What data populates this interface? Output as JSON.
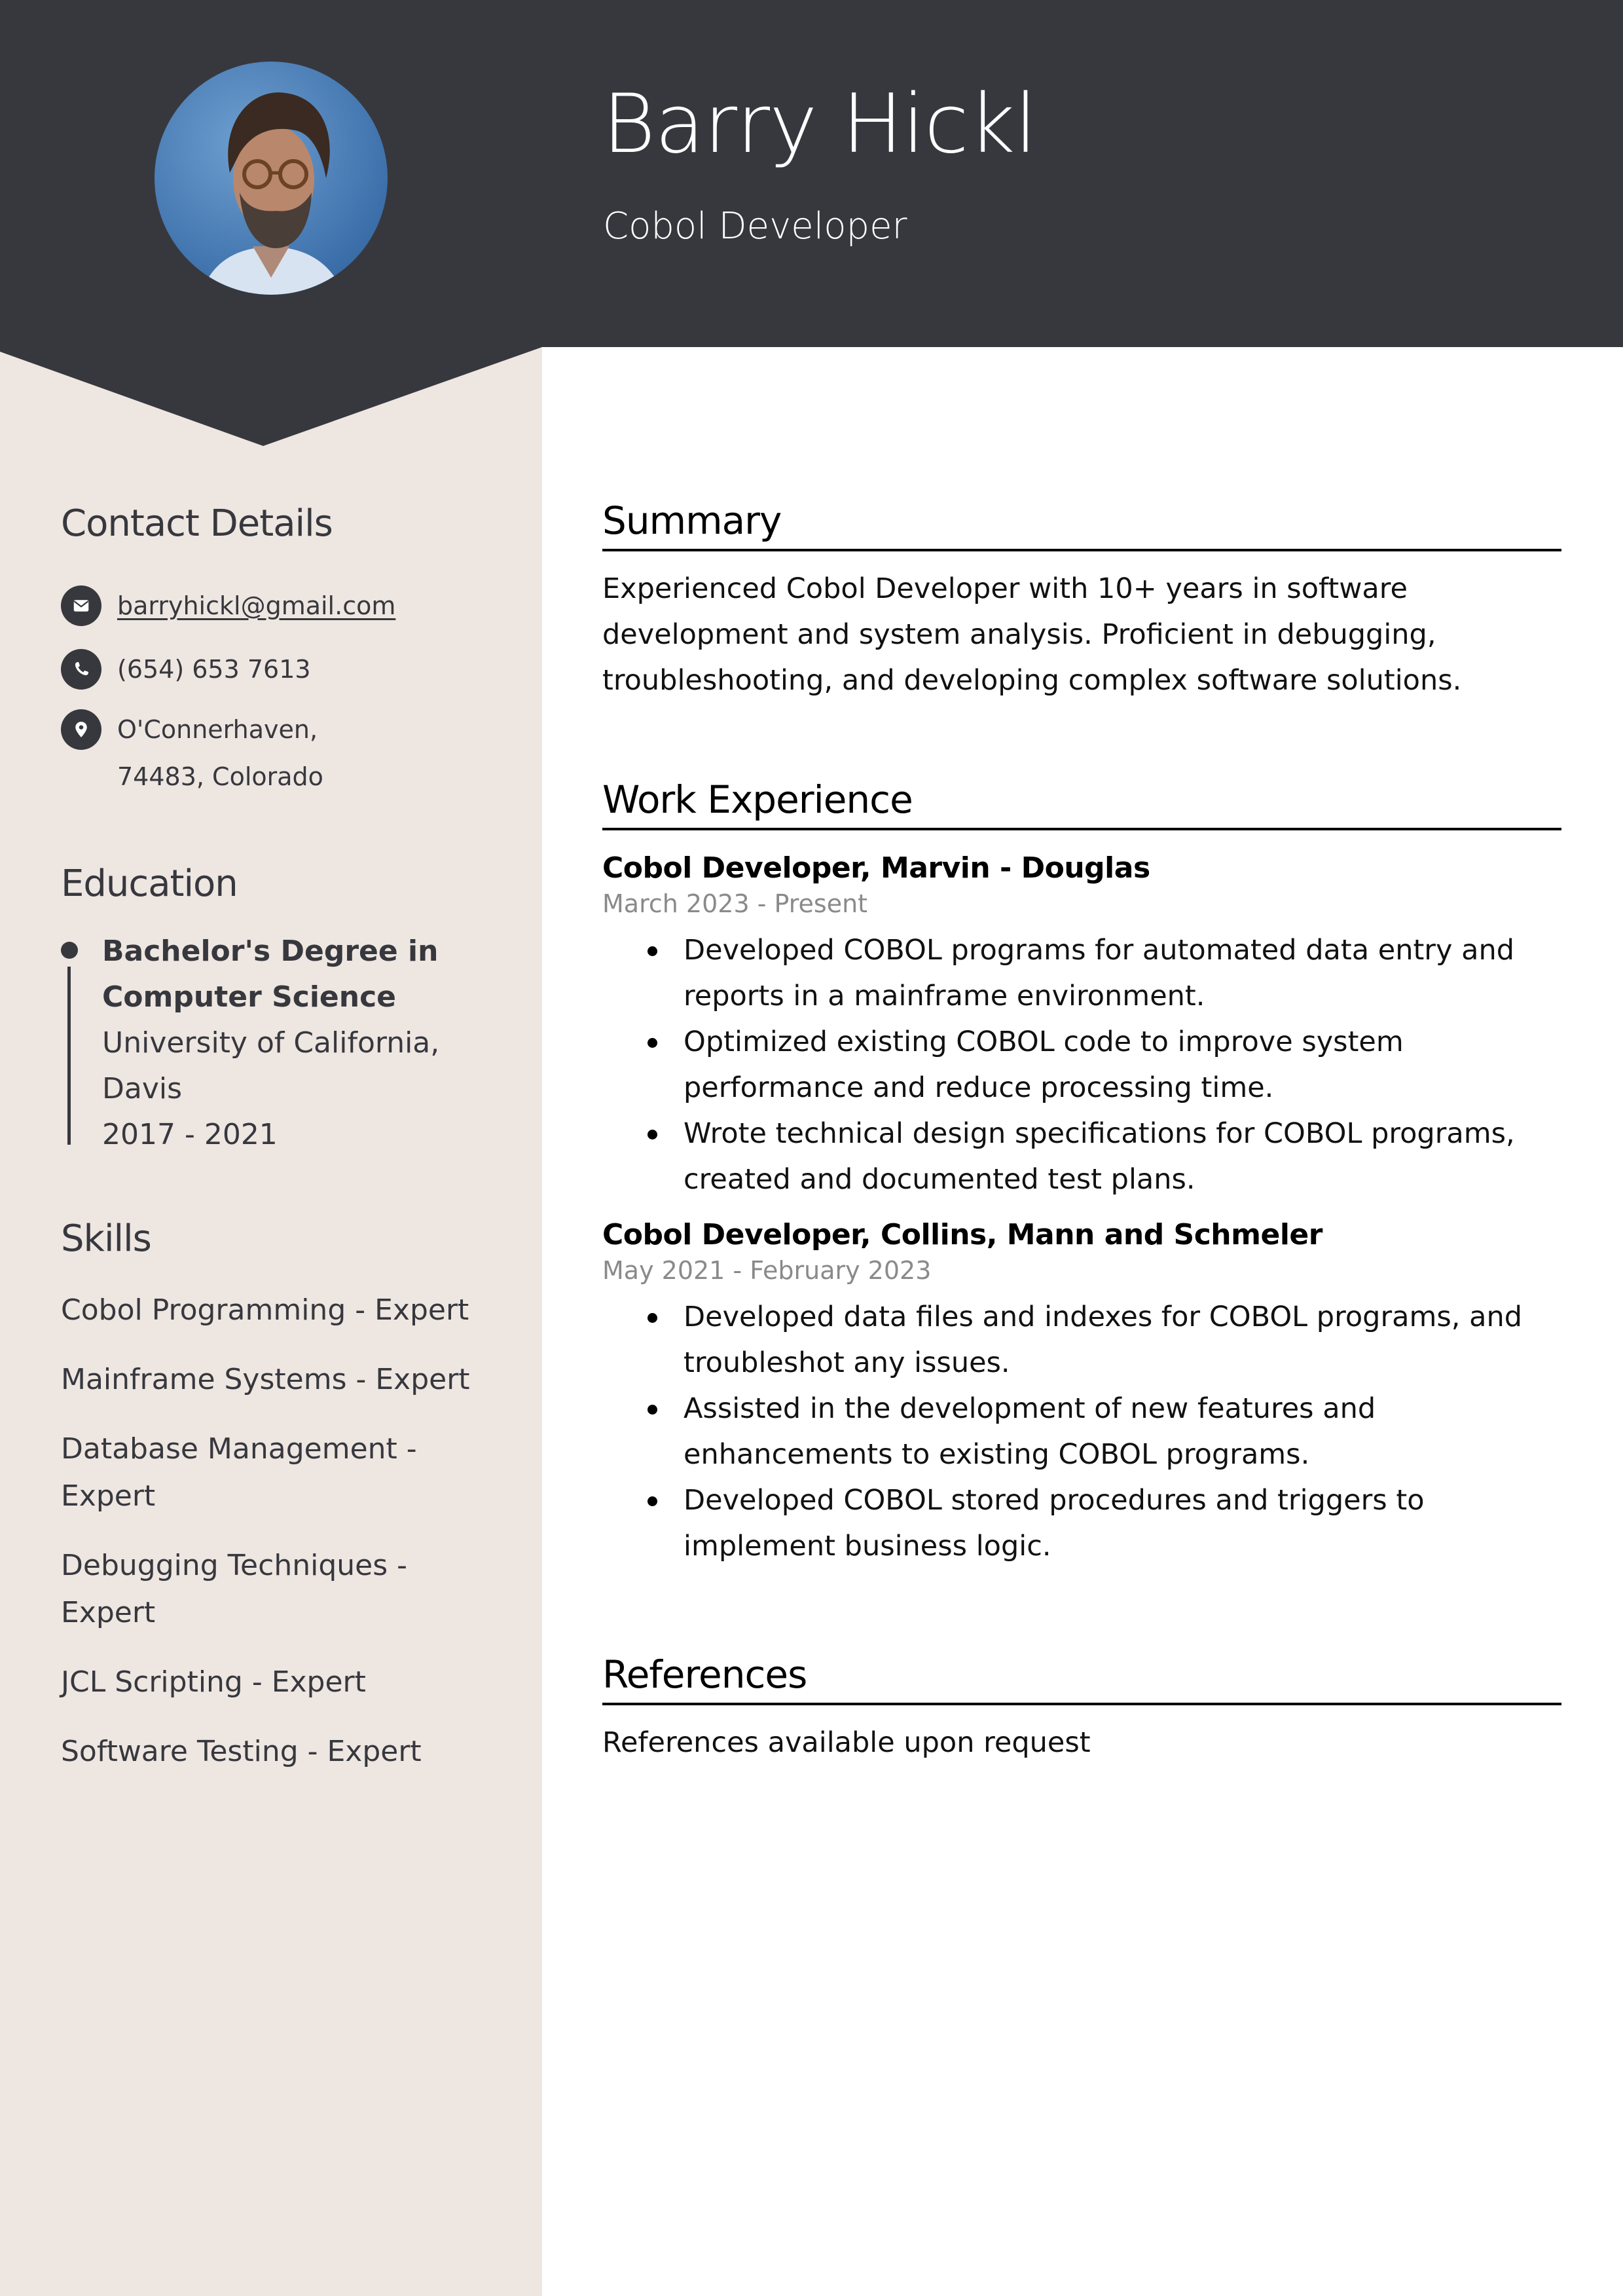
{
  "header": {
    "name": "Barry Hickl",
    "title": "Cobol Developer",
    "photo_alt": "Profile photo"
  },
  "colors": {
    "header_dark": "#37383e",
    "sidebar_bg": "#eee6e1",
    "text_dark": "#37383e",
    "date_gray": "#8a8a8a"
  },
  "sidebar": {
    "contact": {
      "heading": "Contact Details",
      "items": [
        {
          "icon": "envelope-icon",
          "text": "barryhickl@gmail.com"
        },
        {
          "icon": "phone-icon",
          "text": "(654) 653 7613"
        },
        {
          "icon": "location-pin-icon",
          "text": "O'Connerhaven, 74483, Colorado"
        }
      ]
    },
    "education": {
      "heading": "Education",
      "items": [
        {
          "degree": "Bachelor's Degree in Computer Science",
          "school": "University of California, Davis",
          "years": "2017 - 2021"
        }
      ]
    },
    "skills": {
      "heading": "Skills",
      "items": [
        "Cobol Programming - Expert",
        "Mainframe Systems - Expert",
        "Database Management - Expert",
        "Debugging Techniques - Expert",
        "JCL Scripting - Expert",
        "Software Testing - Expert"
      ]
    }
  },
  "main": {
    "summary": {
      "heading": "Summary",
      "text": "Experienced Cobol Developer with 10+ years in software development and system analysis. Proficient in debugging, troubleshooting, and developing complex software solutions."
    },
    "work": {
      "heading": "Work Experience",
      "jobs": [
        {
          "title": "Cobol Developer, Marvin - Douglas",
          "dates": "March 2023 - Present",
          "bullets": [
            "Developed COBOL programs for automated data entry and reports in a mainframe environment.",
            "Optimized existing COBOL code to improve system performance and reduce processing time.",
            "Wrote technical design specifications for COBOL programs, created and documented test plans."
          ]
        },
        {
          "title": "Cobol Developer, Collins, Mann and Schmeler",
          "dates": "May 2021 - February 2023",
          "bullets": [
            "Developed data files and indexes for COBOL programs, and troubleshot any issues.",
            "Assisted in the development of new features and enhancements to existing COBOL programs.",
            "Developed COBOL stored procedures and triggers to implement business logic."
          ]
        }
      ]
    },
    "references": {
      "heading": "References",
      "text": "References available upon request"
    }
  }
}
